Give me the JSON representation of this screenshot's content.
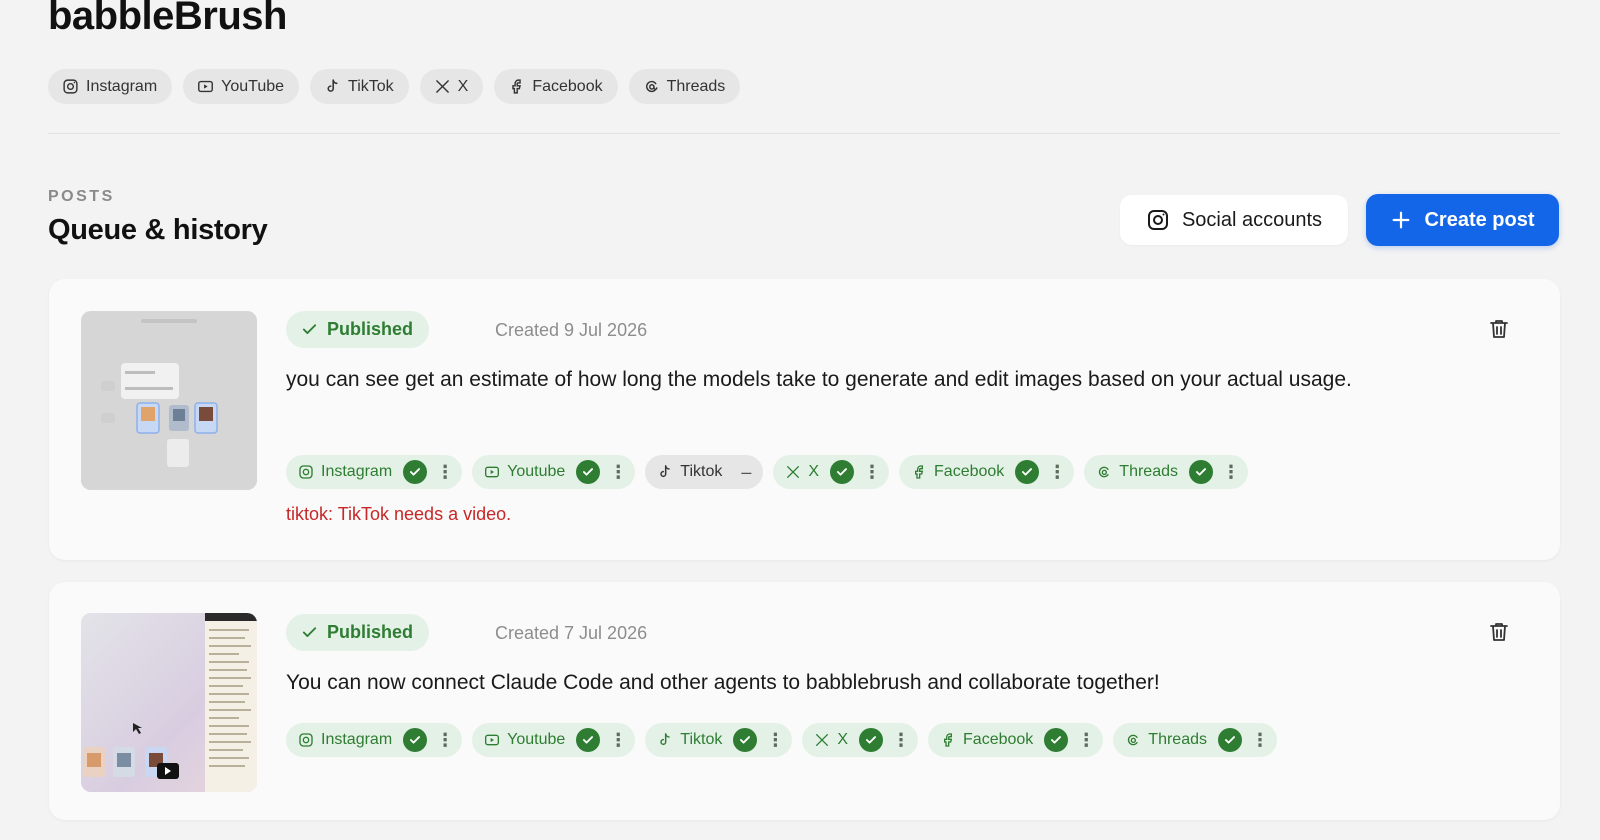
{
  "app": {
    "title": "babbleBrush"
  },
  "filters": [
    {
      "label": "Instagram",
      "icon": "instagram-icon"
    },
    {
      "label": "YouTube",
      "icon": "youtube-icon"
    },
    {
      "label": "TikTok",
      "icon": "tiktok-icon"
    },
    {
      "label": "X",
      "icon": "x-icon"
    },
    {
      "label": "Facebook",
      "icon": "facebook-icon"
    },
    {
      "label": "Threads",
      "icon": "threads-icon"
    }
  ],
  "section": {
    "label": "POSTS",
    "title": "Queue & history",
    "social_accounts_label": "Social accounts",
    "create_post_label": "Create post"
  },
  "colors": {
    "accent": "#1466e9",
    "success": "#2e7d32",
    "success_bg": "#e4f1e6",
    "error": "#c62828"
  },
  "posts": [
    {
      "status": "Published",
      "created": "Created 9 Jul 2026",
      "text": "you can see get an estimate of how long the models take to generate and edit images based on your actual usage.",
      "platforms": [
        {
          "label": "Instagram",
          "state": "published"
        },
        {
          "label": "Youtube",
          "state": "published"
        },
        {
          "label": "Tiktok",
          "state": "skipped"
        },
        {
          "label": "X",
          "state": "published"
        },
        {
          "label": "Facebook",
          "state": "published"
        },
        {
          "label": "Threads",
          "state": "published"
        }
      ],
      "error": "tiktok: TikTok needs a video."
    },
    {
      "status": "Published",
      "created": "Created 7 Jul 2026",
      "text": "You can now connect Claude Code and other agents to babblebrush and collaborate together!",
      "platforms": [
        {
          "label": "Instagram",
          "state": "published"
        },
        {
          "label": "Youtube",
          "state": "published"
        },
        {
          "label": "Tiktok",
          "state": "published"
        },
        {
          "label": "X",
          "state": "published"
        },
        {
          "label": "Facebook",
          "state": "published"
        },
        {
          "label": "Threads",
          "state": "published"
        }
      ]
    }
  ]
}
